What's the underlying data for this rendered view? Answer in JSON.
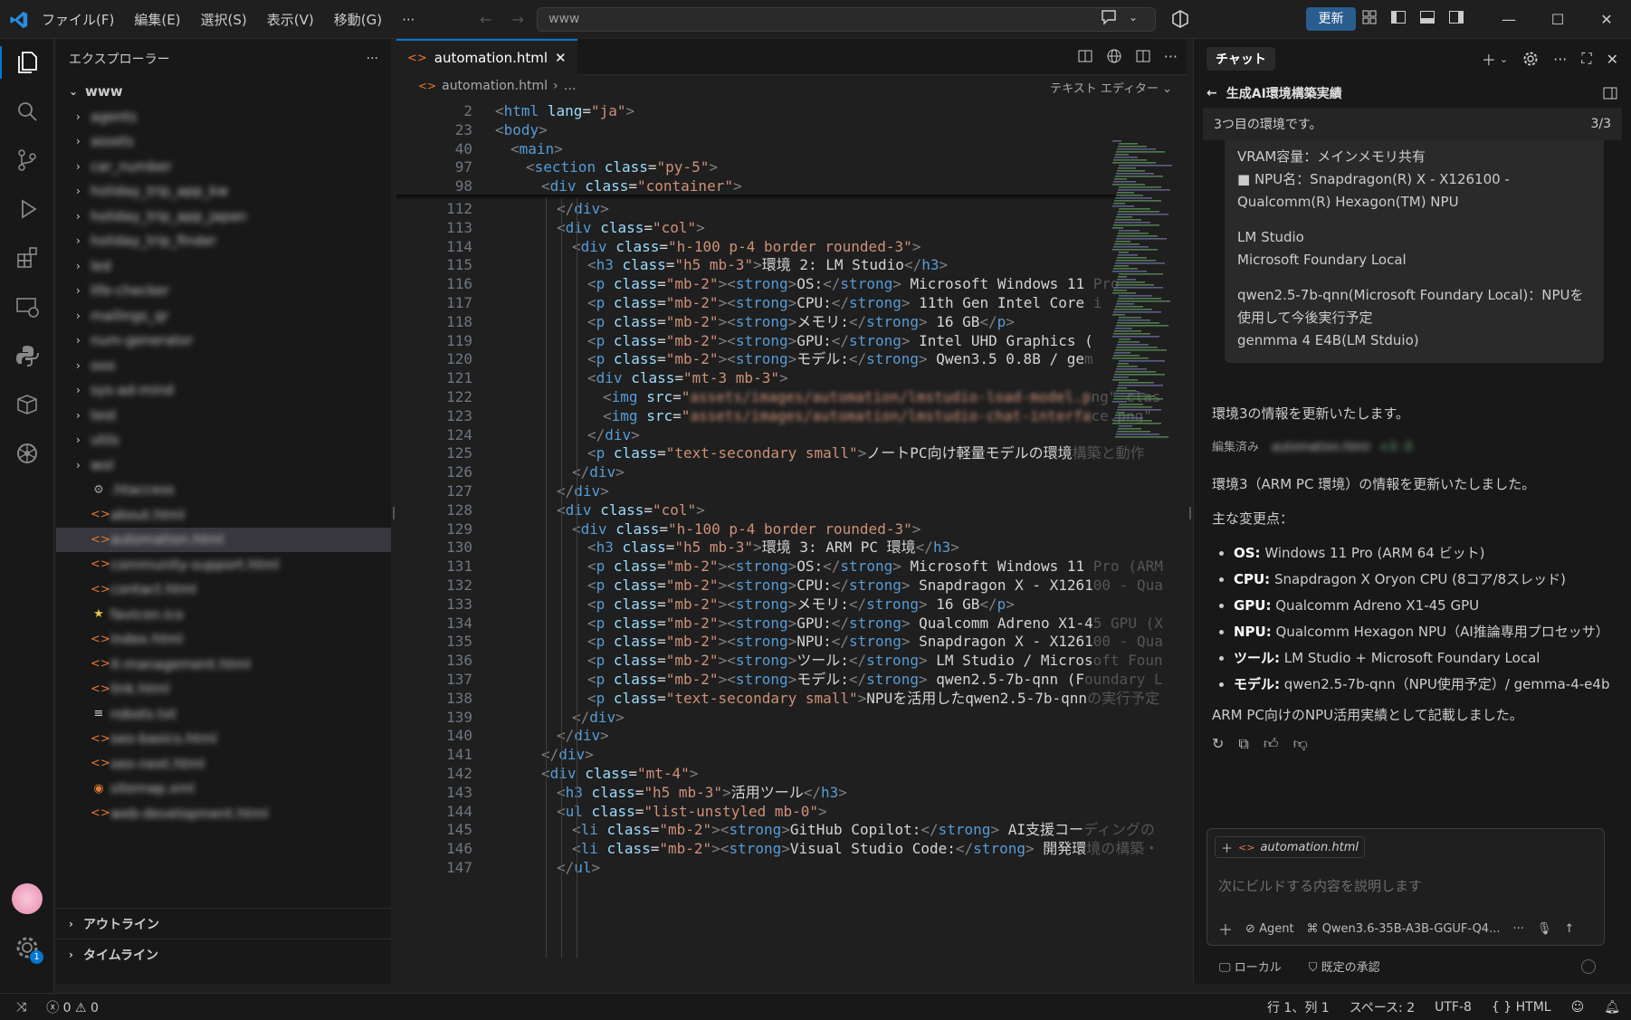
{
  "titlebar": {
    "menus": [
      "ファイル(F)",
      "編集(E)",
      "選択(S)",
      "表示(V)",
      "移動(G)"
    ],
    "more": "···",
    "search": "www",
    "update": "更新"
  },
  "sidebar": {
    "title": "エクスプローラー",
    "more": "···",
    "root": "www",
    "folders": [
      "agents",
      "assets",
      "car_number",
      "holiday_trip_app_kw",
      "holiday_trip_app_japan",
      "holiday_trip_finder",
      "led",
      "life-checker",
      "mailings_qr",
      "num-generator",
      "ooo",
      "sys-ad-mind",
      "test",
      "utils",
      "wol"
    ],
    "files": [
      {
        "name": ".htaccess",
        "icon": "gear"
      },
      {
        "name": "about.html",
        "icon": "html"
      },
      {
        "name": "automation.html",
        "icon": "html",
        "selected": true
      },
      {
        "name": "community-support.html",
        "icon": "html"
      },
      {
        "name": "contact.html",
        "icon": "html"
      },
      {
        "name": "favicon.ico",
        "icon": "star"
      },
      {
        "name": "index.html",
        "icon": "html"
      },
      {
        "name": "it-management.html",
        "icon": "html"
      },
      {
        "name": "link.html",
        "icon": "html"
      },
      {
        "name": "robots.txt",
        "icon": "lines"
      },
      {
        "name": "seo-basics.html",
        "icon": "html"
      },
      {
        "name": "seo-next.html",
        "icon": "html"
      },
      {
        "name": "sitemap.xml",
        "icon": "rss"
      },
      {
        "name": "web-development.html",
        "icon": "html"
      }
    ],
    "outline": "アウトライン",
    "timeline": "タイムライン"
  },
  "editor": {
    "tab": "automation.html",
    "breadcrumb_file": "automation.html",
    "breadcrumb_rest": "…",
    "text_editor": "テキスト エディター",
    "lines": [
      {
        "n": "2",
        "c": "<html lang=\"ja\">",
        "i": 1
      },
      {
        "n": "23",
        "c": "<body>",
        "i": 1
      },
      {
        "n": "40",
        "c": "<main>",
        "i": 2
      },
      {
        "n": "97",
        "c": "<section class=\"py-5\">",
        "i": 3
      },
      {
        "n": "98",
        "c": "<div class=\"container\">",
        "i": 4
      },
      {
        "n": "112",
        "c": "</div>",
        "i": 5
      },
      {
        "n": "113",
        "c": "<div class=\"col\">",
        "i": 5
      },
      {
        "n": "114",
        "c": "<div class=\"h-100 p-4 border rounded-3\">",
        "i": 6
      },
      {
        "n": "115",
        "c": "<h3 class=\"h5 mb-3\">環境 2: LM Studio</h3>",
        "i": 7
      },
      {
        "n": "116",
        "c": "<p class=\"mb-2\"><strong>OS:</strong> Microsoft Windows 11",
        "f": " Pro",
        "i": 7
      },
      {
        "n": "117",
        "c": "<p class=\"mb-2\"><strong>CPU:</strong> 11th Gen Intel Core",
        "f": " i",
        "i": 7
      },
      {
        "n": "118",
        "c": "<p class=\"mb-2\"><strong>メモリ:</strong> 16 GB</p>",
        "i": 7
      },
      {
        "n": "119",
        "c": "<p class=\"mb-2\"><strong>GPU:</strong> Intel UHD Graphics (",
        "i": 7
      },
      {
        "n": "120",
        "c": "<p class=\"mb-2\"><strong>モデル:</strong> Qwen3.5 0.8B / ge",
        "f": "m",
        "i": 7
      },
      {
        "n": "121",
        "c": "<div class=\"mt-3 mb-3\">",
        "i": 7
      },
      {
        "n": "122",
        "c": "<img src=\"",
        "b": "assets/images/automation/lmstudio-load-model.p",
        "f": "ng\" clas",
        "i": 8
      },
      {
        "n": "123",
        "c": "<img src=\"",
        "b": "assets/images/automation/lmstudio-chat-interfa",
        "f": "ce.png\"",
        "i": 8
      },
      {
        "n": "124",
        "c": "</div>",
        "i": 7
      },
      {
        "n": "125",
        "c": "<p class=\"text-secondary small\">ノートPC向け軽量モデルの環境",
        "f": "構築と動作",
        "i": 7
      },
      {
        "n": "126",
        "c": "</div>",
        "i": 6
      },
      {
        "n": "127",
        "c": "</div>",
        "i": 5
      },
      {
        "n": "128",
        "c": "<div class=\"col\">",
        "i": 5
      },
      {
        "n": "129",
        "c": "<div class=\"h-100 p-4 border rounded-3\">",
        "i": 6
      },
      {
        "n": "130",
        "c": "<h3 class=\"h5 mb-3\">環境 3: ARM PC 環境</h3>",
        "i": 7
      },
      {
        "n": "131",
        "c": "<p class=\"mb-2\"><strong>OS:</strong> Microsoft Windows 11",
        "f": " Pro (ARM",
        "i": 7
      },
      {
        "n": "132",
        "c": "<p class=\"mb-2\"><strong>CPU:</strong> Snapdragon X - X1261",
        "f": "00 - Qua",
        "i": 7
      },
      {
        "n": "133",
        "c": "<p class=\"mb-2\"><strong>メモリ:</strong> 16 GB</p>",
        "i": 7
      },
      {
        "n": "134",
        "c": "<p class=\"mb-2\"><strong>GPU:</strong> Qualcomm Adreno X1-4",
        "f": "5 GPU (X",
        "i": 7
      },
      {
        "n": "135",
        "c": "<p class=\"mb-2\"><strong>NPU:</strong> Snapdragon X - X1261",
        "f": "00 - Qua",
        "i": 7
      },
      {
        "n": "136",
        "c": "<p class=\"mb-2\"><strong>ツール:</strong> LM Studio / Micros",
        "f": "oft Foun",
        "i": 7
      },
      {
        "n": "137",
        "c": "<p class=\"mb-2\"><strong>モデル:</strong> qwen2.5-7b-qnn (F",
        "f": "oundary L",
        "i": 7
      },
      {
        "n": "138",
        "c": "<p class=\"text-secondary small\">NPUを活用したqwen2.5-7b-qnn",
        "f": "の実行予定",
        "i": 7
      },
      {
        "n": "139",
        "c": "</div>",
        "i": 6
      },
      {
        "n": "140",
        "c": "</div>",
        "i": 5
      },
      {
        "n": "141",
        "c": "</div>",
        "i": 4
      },
      {
        "n": "142",
        "c": "<div class=\"mt-4\">",
        "i": 4
      },
      {
        "n": "143",
        "c": "<h3 class=\"h5 mb-3\">活用ツール</h3>",
        "i": 5
      },
      {
        "n": "144",
        "c": "<ul class=\"list-unstyled mb-0\">",
        "i": 5
      },
      {
        "n": "145",
        "c": "<li class=\"mb-2\"><strong>GitHub Copilot:</strong> AI支援コー",
        "f": "ディングの",
        "i": 6
      },
      {
        "n": "146",
        "c": "<li class=\"mb-2\"><strong>Visual Studio Code:</strong> 開発環",
        "f": "境の構築・",
        "i": 6
      },
      {
        "n": "147",
        "c": "</ul>",
        "i": 5
      }
    ]
  },
  "chat": {
    "tab": "チャット",
    "session_title": "生成AI環境構築実績",
    "progress_text": "3つ目の環境です。",
    "progress_count": "3/3",
    "card_lines": [
      "VRAM容量：メインメモリ共有",
      "■ NPU名：Snapdragon(R) X - X126100 - Qualcomm(R) Hexagon(TM) NPU",
      "",
      "LM Studio",
      "Microsoft Foundary Local",
      "",
      "qwen2.5-7b-qnn(Microsoft Foundary Local)：NPUを使用して今後実行予定",
      "genmma 4 E4B(LM Stduio)"
    ],
    "msg1": "環境3の情報を更新いたします。",
    "edited_label": "編集済み",
    "edited_file": "automation.html",
    "edited_diff": "+3 -3",
    "msg2": "環境3（ARM PC 環境）の情報を更新いたしました。",
    "changes_title": "主な変更点：",
    "changes": [
      {
        "k": "OS:",
        "v": " Windows 11 Pro (ARM 64 ビット)"
      },
      {
        "k": "CPU:",
        "v": " Snapdragon X Oryon CPU (8コア/8スレッド)"
      },
      {
        "k": "GPU:",
        "v": " Qualcomm Adreno X1-45 GPU"
      },
      {
        "k": "NPU:",
        "v": " Qualcomm Hexagon NPU（AI推論専用プロセッサ）"
      },
      {
        "k": "ツール:",
        "v": " LM Studio + Microsoft Foundary Local"
      },
      {
        "k": "モデル:",
        "v": " qwen2.5-7b-qnn（NPU使用予定）/ gemma-4-e4b"
      }
    ],
    "msg3": "ARM PC向けのNPU活用実績として記載しました。",
    "context_chip": "automation.html",
    "input_placeholder": "次にビルドする内容を説明します",
    "agent": "Agent",
    "model": "Qwen3.6-35B-A3B-GGUF-Q4...",
    "more": "···",
    "local": "ローカル",
    "approval": "既定の承認"
  },
  "status": {
    "errors": "0",
    "warnings": "0",
    "position": "行 1、列 1",
    "spaces": "スペース: 2",
    "encoding": "UTF-8",
    "language": "HTML",
    "lang_prefix": "{ }"
  },
  "colors": {
    "accent": "#0078d4",
    "tag": "#569cd6",
    "attr": "#9cdcfe",
    "string": "#ce9178",
    "html_icon": "#e37933"
  }
}
